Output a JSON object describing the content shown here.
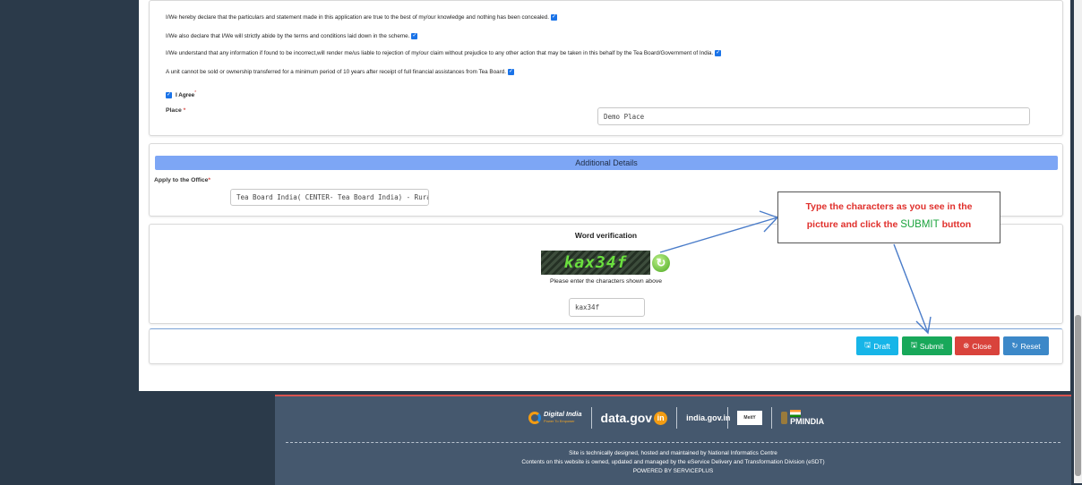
{
  "declarations": [
    "I/We hereby declare that the particulars and statement made in this application are true to the best of my/our knowledge and nothing has been concealed.",
    "I/We also declare that I/We will strictly abide by the terms and conditions laid down in the scheme.",
    "I/We understand that any information if found to be incorrect,will render me/us liable to rejection of my/our claim without prejudice to any other action that may be taken in this behalf by the Tea Board/Government of India.",
    "A unit cannot be sold or ownership transferred for a minimum period of 10 years after receipt of full financial assistances from Tea Board."
  ],
  "agree": {
    "label": "I Agree",
    "required_mark": "*"
  },
  "place": {
    "label": "Place",
    "required_mark": "*",
    "value": "Demo Place"
  },
  "additional": {
    "title": "Additional Details",
    "office_label": "Apply to the Office",
    "required_mark": "*",
    "office_value": "Tea Board India( CENTER- Tea Board India) - Rural/U"
  },
  "verification": {
    "title": "Word verification",
    "captcha_text": "kax34f",
    "instruction": "Please enter the characters shown above",
    "input_value": "kax34f"
  },
  "buttons": {
    "draft": "Draft",
    "submit": "Submit",
    "close": "Close",
    "reset": "Reset"
  },
  "callout": {
    "line1": "Type the characters as you see in the",
    "line2_prefix": "picture and click the ",
    "line2_highlight": "SUBMIT",
    "line2_suffix": " button"
  },
  "footer": {
    "logos": [
      "Digital India",
      "data.gov",
      "india.gov.in",
      "MeitY",
      "PMINDIA"
    ],
    "digital_india_sub": "Power To Empower",
    "line1": "Site is technically designed, hosted and maintained by National Informatics Centre",
    "line2": "Contents on this website is owned, updated and managed by the eService Delivery and Transformation Division (eSDT)",
    "line3": "POWERED BY SERVICEPLUS"
  },
  "colors": {
    "draft": "#17b5e8",
    "submit": "#18a85a",
    "close": "#d9433c",
    "reset": "#3c88c8",
    "header_bar": "#7da6f5",
    "callout_text": "#e0302c",
    "callout_highlight": "#1aa33c"
  }
}
